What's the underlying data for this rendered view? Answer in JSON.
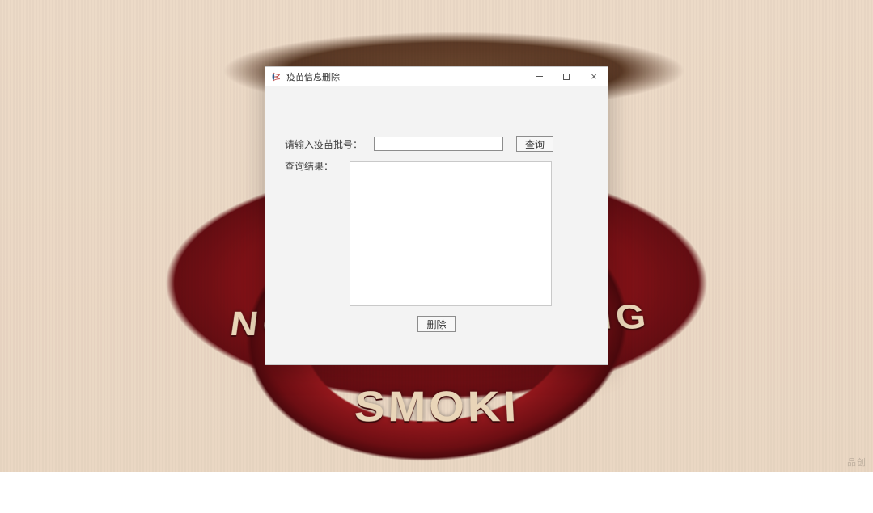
{
  "window": {
    "title": "疫苗信息删除",
    "controls": {
      "minimize": "—",
      "maximize": "□",
      "close": "×"
    }
  },
  "form": {
    "batch_label": "请输入疫苗批号：",
    "batch_value": "",
    "query_button": "查询",
    "result_label": "查询结果：",
    "result_value": "",
    "delete_button": "删除"
  },
  "background": {
    "shield_text_main": "SMOKI",
    "shield_text_left": "NO",
    "shield_text_right": "NG"
  },
  "watermark": "品创"
}
